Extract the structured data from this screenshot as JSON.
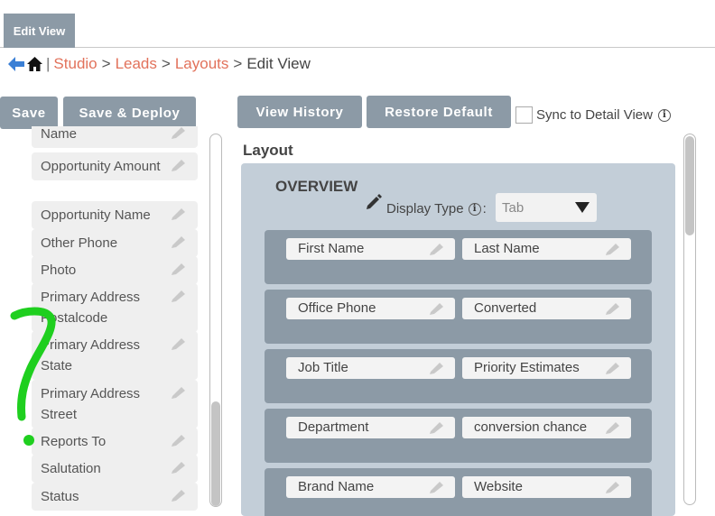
{
  "tab": {
    "label": "Edit View"
  },
  "breadcrumb": {
    "items": [
      "Studio",
      "Leads",
      "Layouts"
    ],
    "separator": ">",
    "current": "Edit View"
  },
  "toolbar": {
    "save": "Save",
    "save_deploy": "Save & Deploy",
    "view_history": "View History",
    "restore_default": "Restore Default",
    "sync_label": "Sync to Detail View",
    "sync_checked": false
  },
  "available_fields": [
    "Name",
    "Opportunity Amount",
    "Opportunity Name",
    "Other Phone",
    "Photo",
    "Primary Address Postalcode",
    "Primary Address State",
    "Primary Address Street",
    "Reports To",
    "Salutation",
    "Status"
  ],
  "layout": {
    "title": "Layout",
    "panel": {
      "name": "OVERVIEW",
      "display_type_label": "Display Type",
      "display_type_sep": ":",
      "display_type_value": "Tab",
      "rows": [
        [
          "First Name",
          "Last Name"
        ],
        [
          "Office Phone",
          "Converted"
        ],
        [
          "Job Title",
          "Priority Estimates"
        ],
        [
          "Department",
          "conversion chance"
        ],
        [
          "Brand Name",
          "Website"
        ]
      ]
    }
  },
  "colors": {
    "accent": "#8c9aa6",
    "link": "#e2725b",
    "panel": "#c3ced8",
    "annotation": "#1fcf1f"
  },
  "icons": {
    "back": "back-arrow-icon",
    "home": "home-icon",
    "edit": "pencil-icon",
    "info": "info-icon"
  }
}
